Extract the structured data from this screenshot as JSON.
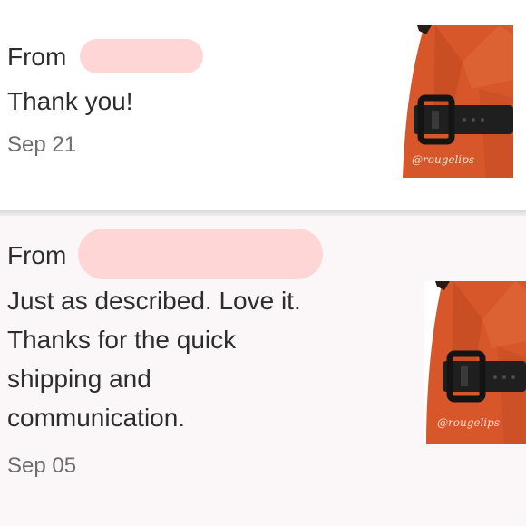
{
  "reviews": [
    {
      "from_label": "From",
      "text_lines": [
        "Thank you!"
      ],
      "date": "Sep 21",
      "photo": {
        "alt": "Rust orange wrap top with wide black buckle belt",
        "watermark": "@rougelips"
      }
    },
    {
      "from_label": "From",
      "text_lines": [
        "Just as described. Love it.",
        "Thanks for the quick",
        "shipping and",
        "communication."
      ],
      "date": "Sep 05",
      "photo": {
        "alt": "Rust orange wrap top with wide black buckle belt",
        "watermark": "@rougelips"
      }
    }
  ],
  "colors": {
    "card_1_bg": "#ffffff",
    "card_2_bg": "#fbf7f8",
    "redaction": "#ffd6d6",
    "garment": "#d7572a",
    "belt": "#1f1f1f"
  }
}
